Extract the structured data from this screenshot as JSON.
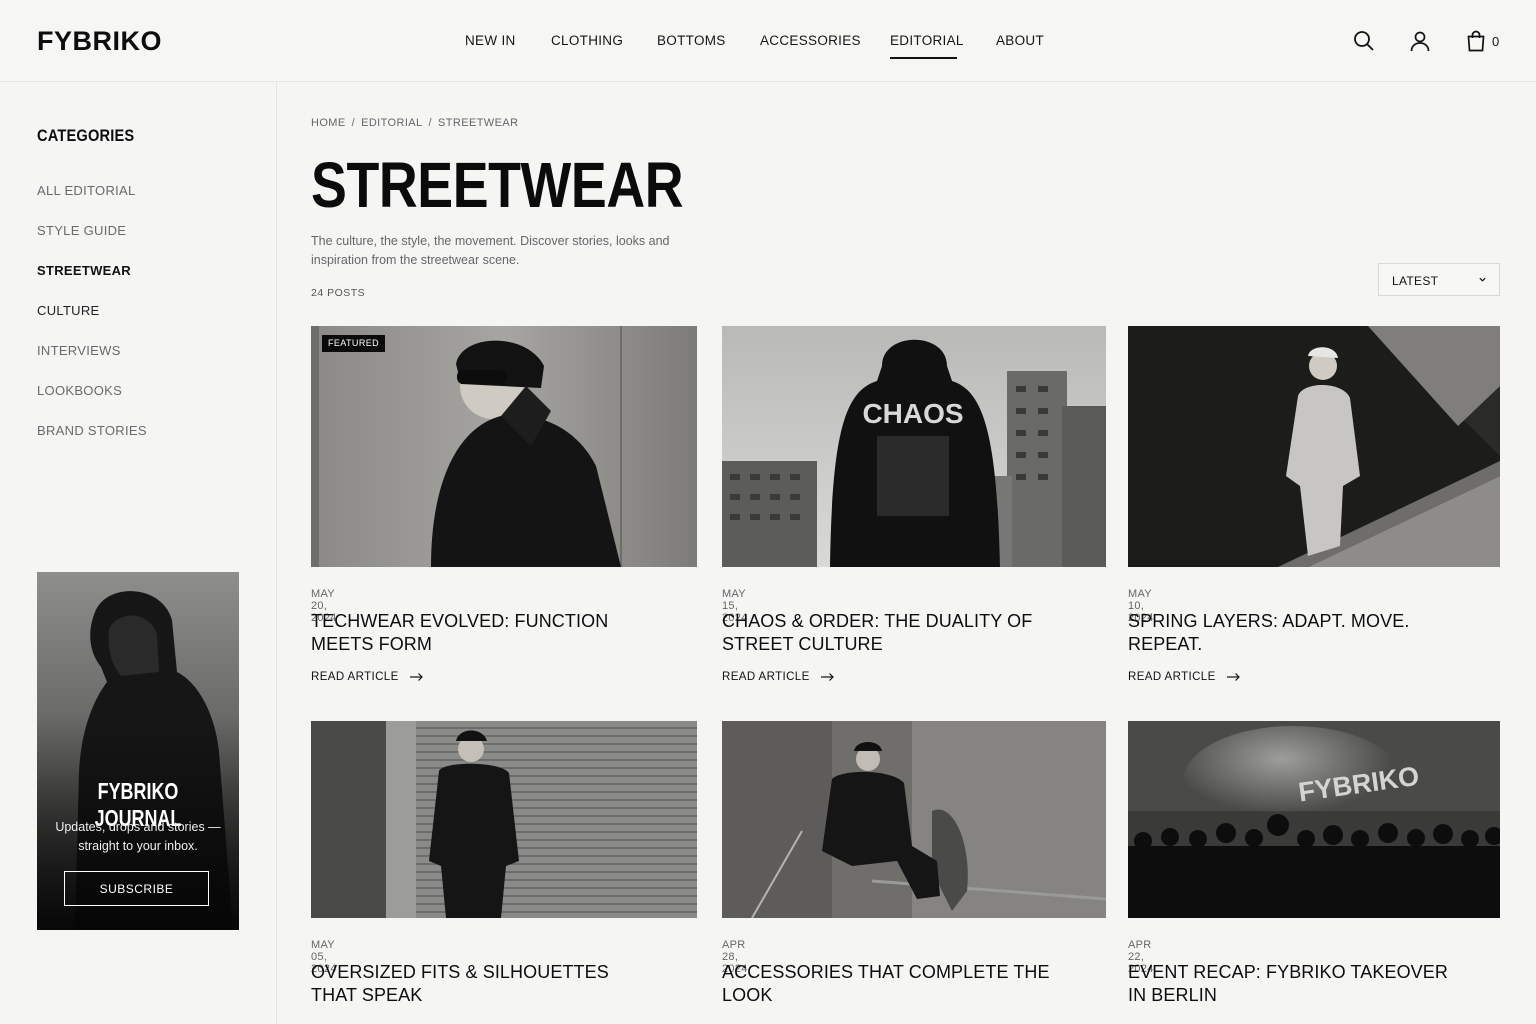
{
  "brand": {
    "logo": "FYBRIKO"
  },
  "nav": {
    "items": [
      {
        "label": "NEW IN"
      },
      {
        "label": "CLOTHING"
      },
      {
        "label": "BOTTOMS"
      },
      {
        "label": "ACCESSORIES"
      },
      {
        "label": "EDITORIAL",
        "active": true
      },
      {
        "label": "ABOUT"
      }
    ],
    "icons": [
      "search-icon",
      "user-icon",
      "bag-icon"
    ],
    "cart_count": "0"
  },
  "sidebar": {
    "title": "CATEGORIES",
    "items": [
      {
        "label": "ALL EDITORIAL"
      },
      {
        "label": "STYLE GUIDE"
      },
      {
        "label": "STREETWEAR",
        "active": true
      },
      {
        "label": "CULTURE"
      },
      {
        "label": "INTERVIEWS"
      },
      {
        "label": "LOOKBOOKS"
      },
      {
        "label": "BRAND STORIES"
      }
    ],
    "promo": {
      "title": "FYBRIKO JOURNAL",
      "text": "Updates, drops and stories — straight to your inbox.",
      "button": "SUBSCRIBE"
    }
  },
  "breadcrumb": [
    "HOME",
    "EDITORIAL",
    "STREETWEAR"
  ],
  "page": {
    "title": "STREETWEAR",
    "description": "The culture, the style, the movement. Discover stories, looks and inspiration from the streetwear scene.",
    "post_count": "24 POSTS",
    "sort": {
      "selected": "LATEST"
    }
  },
  "posts": [
    {
      "badge": "FEATURED",
      "date": "MAY 20, 2024",
      "title": "TECHWEAR EVOLVED: FUNCTION MEETS FORM",
      "link": "READ ARTICLE"
    },
    {
      "date": "MAY 15, 2024",
      "title": "CHAOS & ORDER: THE DUALITY OF STREET CULTURE",
      "link": "READ ARTICLE",
      "image_text": "CHAOS"
    },
    {
      "date": "MAY 10, 2024",
      "title": "SPRING LAYERS: ADAPT. MOVE. REPEAT.",
      "link": "READ ARTICLE"
    },
    {
      "date": "MAY 05, 2024",
      "title": "OVERSIZED FITS & SILHOUETTES THAT SPEAK"
    },
    {
      "date": "APR 28, 2024",
      "title": "ACCESSORIES THAT COMPLETE THE LOOK"
    },
    {
      "date": "APR 22, 2024",
      "title": "EVENT RECAP: FYBRIKO TAKEOVER IN BERLIN",
      "image_text": "FYBRIKO"
    }
  ],
  "colors": {
    "background": "#f5f5f4",
    "text": "#111111",
    "muted": "#666666",
    "border": "#e4e4e2"
  }
}
